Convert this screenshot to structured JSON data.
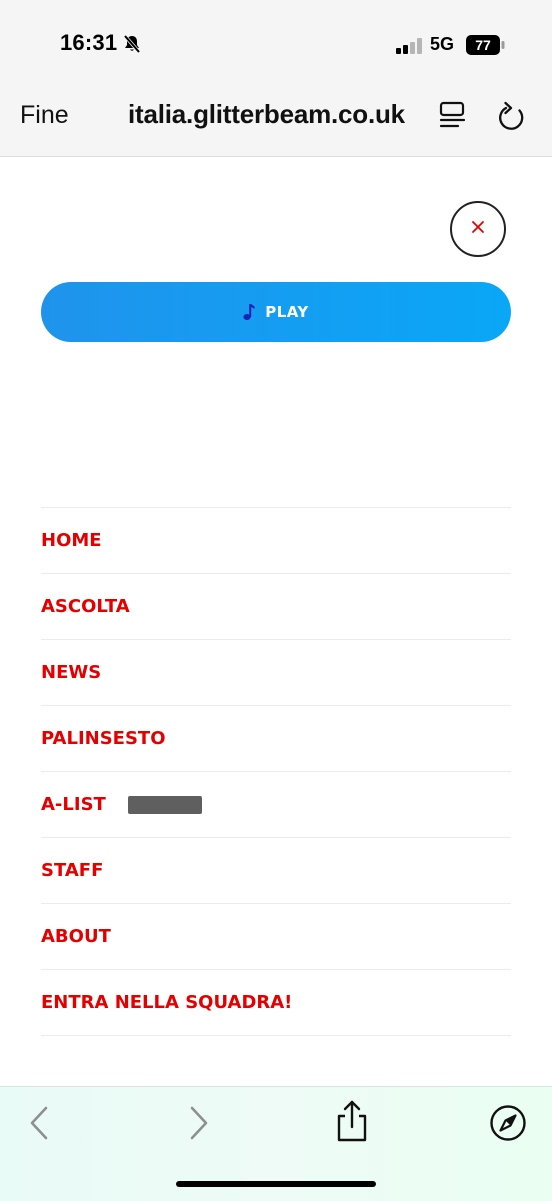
{
  "status_bar": {
    "time": "16:31",
    "network": "5G",
    "battery": "77",
    "icons": [
      "bell-slash-icon",
      "signal-icon",
      "battery-icon"
    ]
  },
  "browser": {
    "done_label": "Fine",
    "url": "italia.glitterbeam.co.uk",
    "icons": [
      "reader-icon",
      "reload-icon"
    ]
  },
  "player": {
    "play_label": "PLAY",
    "icon": "music-note-icon"
  },
  "menu": {
    "items": [
      {
        "label": "HOME"
      },
      {
        "label": "ASCOLTA"
      },
      {
        "label": "NEWS"
      },
      {
        "label": "PALINSESTO"
      },
      {
        "label": "A-LIST"
      },
      {
        "label": "STAFF"
      },
      {
        "label": "ABOUT"
      },
      {
        "label": "ENTRA NELLA SQUADRA!"
      }
    ]
  },
  "bottom_toolbar": {
    "icons": [
      "back-icon",
      "forward-icon",
      "share-icon",
      "compass-icon"
    ]
  },
  "colors": {
    "menu_text": "#e40000",
    "play_button": "#0aa7f7",
    "close_x": "#e40000"
  }
}
